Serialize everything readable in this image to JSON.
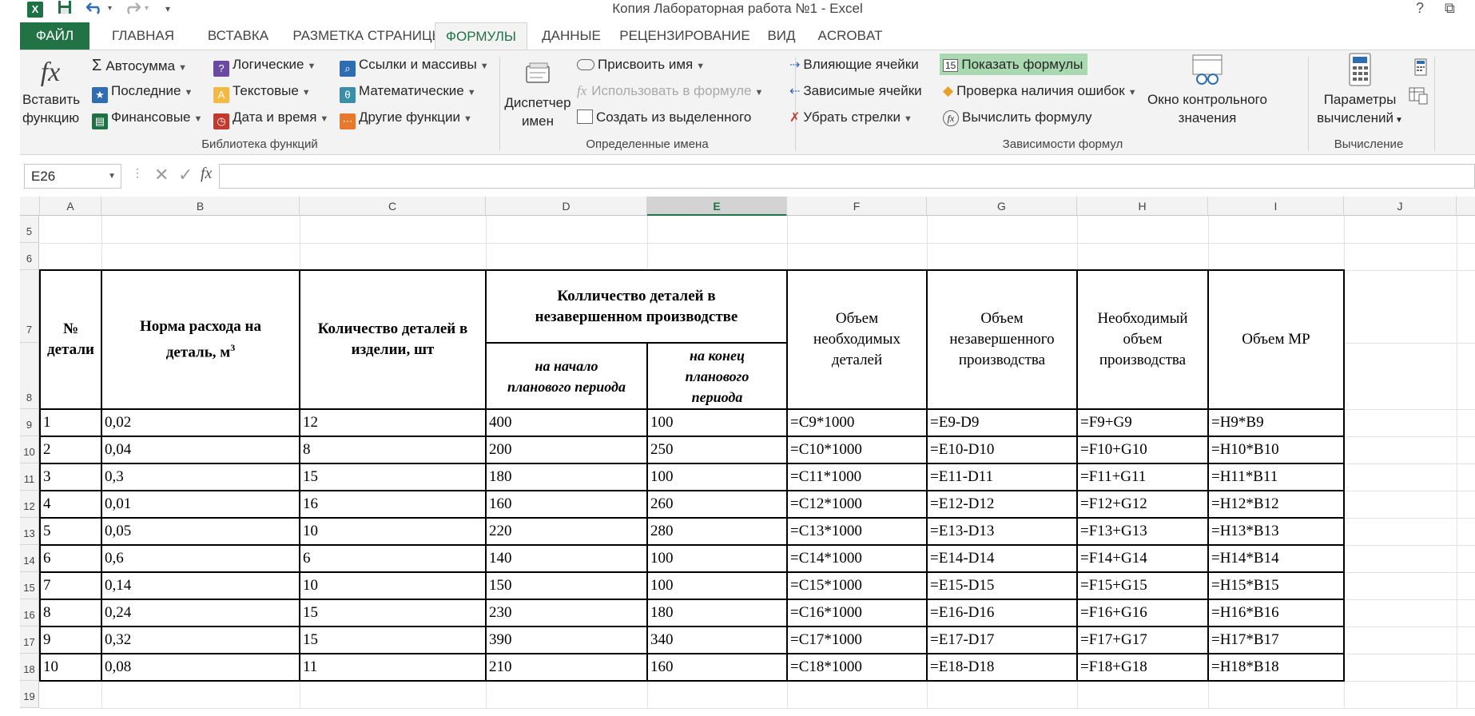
{
  "window": {
    "title": "Копия Лабораторная работа №1 - Excel",
    "help_glyph": "?",
    "restore_glyph": "⧉"
  },
  "qat": {
    "excel_icon": "X",
    "save_icon": "save-icon",
    "undo_icon": "undo-icon",
    "redo_icon": "redo-icon"
  },
  "tabs": [
    "ФАЙЛ",
    "ГЛАВНАЯ",
    "ВСТАВКА",
    "РАЗМЕТКА СТРАНИЦЫ",
    "ФОРМУЛЫ",
    "ДАННЫЕ",
    "РЕЦЕНЗИРОВАНИЕ",
    "ВИД",
    "ACROBAT"
  ],
  "ribbon": {
    "insert_function": {
      "line1": "Вставить",
      "line2": "функцию",
      "glyph": "fx"
    },
    "library": {
      "autosum": "Автосумма",
      "recent": "Последние",
      "financial": "Финансовые",
      "logical": "Логические",
      "text": "Текстовые",
      "datetime": "Дата и время",
      "lookup": "Ссылки и массивы",
      "math": "Математические",
      "other": "Другие функции",
      "label": "Библиотека функций"
    },
    "names": {
      "manager_line1": "Диспетчер",
      "manager_line2": "имен",
      "assign": "Присвоить имя",
      "use_in_formula": "Использовать в формуле",
      "create_from_selection": "Создать из выделенного",
      "label": "Определенные имена"
    },
    "auditing": {
      "trace_precedents": "Влияющие ячейки",
      "trace_dependents": "Зависимые ячейки",
      "remove_arrows": "Убрать стрелки",
      "show_formulas": "Показать формулы",
      "error_checking": "Проверка наличия ошибок",
      "evaluate": "Вычислить формулу",
      "watch_line1": "Окно контрольного",
      "watch_line2": "значения",
      "label": "Зависимости формул"
    },
    "calc": {
      "options_line1": "Параметры",
      "options_line2": "вычислений",
      "label": "Вычисление"
    }
  },
  "formula_bar": {
    "name_box": "E26",
    "cancel": "✕",
    "enter": "✓",
    "fx": "fx",
    "value": ""
  },
  "columns": [
    "A",
    "B",
    "C",
    "D",
    "E",
    "F",
    "G",
    "H",
    "I",
    "J"
  ],
  "rows": [
    "5",
    "6",
    "7",
    "8",
    "9",
    "10",
    "11",
    "12",
    "13",
    "14",
    "15",
    "16",
    "17",
    "18",
    "19"
  ],
  "table_headers": {
    "no_line1": "№",
    "no_line2": "детали",
    "norm_line1": "Норма расхода на",
    "norm_line2": "деталь, м",
    "norm_sup": "3",
    "qty_line1": "Количество деталей в",
    "qty_line2": "изделии, шт",
    "wip_line1": "Колличество деталей в",
    "wip_line2": "незавершенном производстве",
    "start_line1": "на начало",
    "start_line2": "планового периода",
    "end_line1": "на конец",
    "end_line2": "планового",
    "end_line3": "периода",
    "vol_line1": "Объем",
    "vol_line2": "необходимых",
    "vol_line3": "деталей",
    "wipvol_line1": "Объем",
    "wipvol_line2": "незавершенного",
    "wipvol_line3": "производства",
    "need_line1": "Необходимый",
    "need_line2": "объем",
    "need_line3": "производства",
    "mr": "Объем МР"
  },
  "table_rows": [
    [
      "1",
      "0,02",
      "12",
      "400",
      "100",
      "=C9*1000",
      "=E9-D9",
      "=F9+G9",
      "=H9*B9"
    ],
    [
      "2",
      "0,04",
      "8",
      "200",
      "250",
      "=C10*1000",
      "=E10-D10",
      "=F10+G10",
      "=H10*B10"
    ],
    [
      "3",
      "0,3",
      "15",
      "180",
      "100",
      "=C11*1000",
      "=E11-D11",
      "=F11+G11",
      "=H11*B11"
    ],
    [
      "4",
      "0,01",
      "16",
      "160",
      "260",
      "=C12*1000",
      "=E12-D12",
      "=F12+G12",
      "=H12*B12"
    ],
    [
      "5",
      "0,05",
      "10",
      "220",
      "280",
      "=C13*1000",
      "=E13-D13",
      "=F13+G13",
      "=H13*B13"
    ],
    [
      "6",
      "0,6",
      "6",
      "140",
      "100",
      "=C14*1000",
      "=E14-D14",
      "=F14+G14",
      "=H14*B14"
    ],
    [
      "7",
      "0,14",
      "10",
      "150",
      "100",
      "=C15*1000",
      "=E15-D15",
      "=F15+G15",
      "=H15*B15"
    ],
    [
      "8",
      "0,24",
      "15",
      "230",
      "180",
      "=C16*1000",
      "=E16-D16",
      "=F16+G16",
      "=H16*B16"
    ],
    [
      "9",
      "0,32",
      "15",
      "390",
      "340",
      "=C17*1000",
      "=E17-D17",
      "=F17+G17",
      "=H17*B17"
    ],
    [
      "10",
      "0,08",
      "11",
      "210",
      "160",
      "=C18*1000",
      "=E18-D18",
      "=F18+G18",
      "=H18*B18"
    ]
  ],
  "colors": {
    "excel_green": "#217346",
    "show_formulas_active": "#a9d8b1"
  }
}
